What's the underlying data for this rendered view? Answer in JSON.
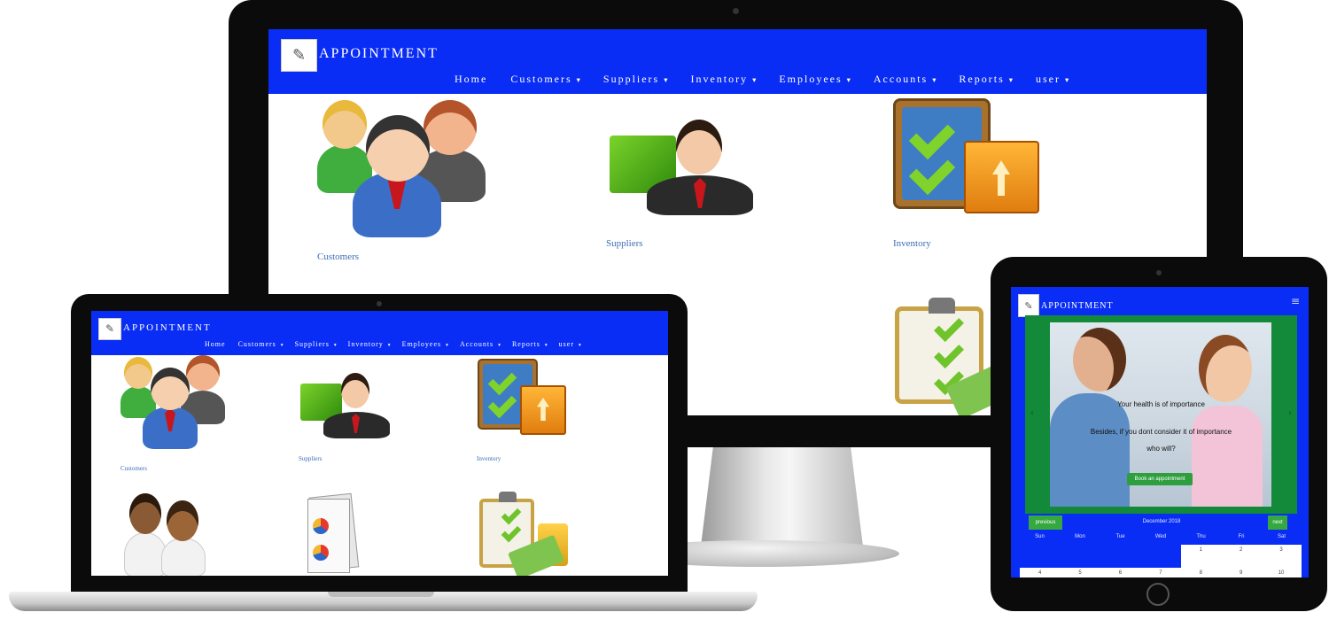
{
  "app": {
    "brand": "APPOINTMENT",
    "logo_icon": "appointment-notepad-icon",
    "accent": "#0a2df5"
  },
  "nav": {
    "home": "Home",
    "customers": "Customers",
    "suppliers": "Suppliers",
    "inventory": "Inventory",
    "employees": "Employees",
    "accounts": "Accounts",
    "reports": "Reports",
    "user": "user",
    "caret": "▾"
  },
  "tiles": {
    "customers": "Customers",
    "suppliers": "Suppliers",
    "inventory": "Inventory"
  },
  "tablet": {
    "menu_icon": "≡",
    "hero_line1": "Your health is of importance",
    "hero_line2": "Besides, if you dont consider it of importance",
    "hero_line3": "who will?",
    "book_button": "Book an appointment",
    "prev_button": "previous",
    "next_button": "next",
    "month": "December 2018",
    "weekdays": [
      "Sun",
      "Mon",
      "Tue",
      "Wed",
      "Thu",
      "Fri",
      "Sat"
    ],
    "week1": [
      "",
      "",
      "",
      "",
      "1",
      "2",
      "3"
    ],
    "week2": [
      "4",
      "5",
      "6",
      "7",
      "8",
      "9",
      "10"
    ]
  }
}
